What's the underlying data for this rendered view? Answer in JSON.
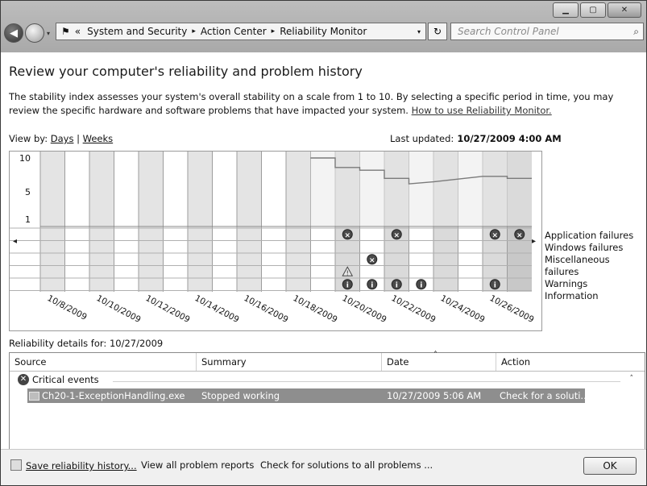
{
  "window": {
    "minimize": "▁",
    "maximize": "▢",
    "close": "✕"
  },
  "nav": {
    "back_icon": "back-arrow-icon",
    "forward_icon": "forward-arrow-icon",
    "recent_dropdown": "▾"
  },
  "address": {
    "prefix": "«",
    "crumbs": [
      "System and Security",
      "Action Center",
      "Reliability Monitor"
    ],
    "separator": "▸",
    "dropdown": "▾"
  },
  "refresh_label": "↻",
  "search": {
    "placeholder": "Search Control Panel",
    "icon": "⌕"
  },
  "page": {
    "title": "Review your computer's reliability and problem history",
    "description": "The stability index assesses your system's overall stability on a scale from 1 to 10. By selecting a specific period in time, you may review the specific hardware and software problems that have impacted your system.",
    "help_link": "How to use Reliability Monitor.",
    "view_by_label": "View by:",
    "view_days": "Days",
    "view_sep": "|",
    "view_weeks": "Weeks",
    "last_updated_label": "Last updated:",
    "last_updated_value": "10/27/2009 4:00 AM"
  },
  "chart_data": {
    "type": "line",
    "title": "",
    "y_ticks": [
      "10",
      "5",
      "1"
    ],
    "ylim": [
      1,
      10
    ],
    "x_labels": [
      "10/8/2009",
      "10/10/2009",
      "10/12/2009",
      "10/14/2009",
      "10/16/2009",
      "10/18/2009",
      "10/20/2009",
      "10/22/2009",
      "10/24/2009",
      "10/26/2009"
    ],
    "columns": 20,
    "first_data_column": 12,
    "stability_index": [
      {
        "column": 12,
        "value": 10
      },
      {
        "column": 13,
        "value": 8.6
      },
      {
        "column": 14,
        "value": 8.2
      },
      {
        "column": 15,
        "value": 7.0
      },
      {
        "column": 16,
        "value": 6.2
      },
      {
        "column": 17,
        "value": 6.5
      },
      {
        "column": 18,
        "value": 6.9
      },
      {
        "column": 19,
        "value": 7.3
      },
      {
        "column": 20,
        "value": 7.0
      }
    ],
    "rows": [
      "Application failures",
      "Windows failures",
      "Miscellaneous failures",
      "Warnings",
      "Information"
    ],
    "events": [
      {
        "column": 13,
        "row": 0,
        "kind": "error"
      },
      {
        "column": 15,
        "row": 0,
        "kind": "error"
      },
      {
        "column": 19,
        "row": 0,
        "kind": "error"
      },
      {
        "column": 20,
        "row": 0,
        "kind": "error"
      },
      {
        "column": 14,
        "row": 2,
        "kind": "error"
      },
      {
        "column": 13,
        "row": 3,
        "kind": "warning"
      },
      {
        "column": 13,
        "row": 4,
        "kind": "info"
      },
      {
        "column": 14,
        "row": 4,
        "kind": "info"
      },
      {
        "column": 15,
        "row": 4,
        "kind": "info"
      },
      {
        "column": 16,
        "row": 4,
        "kind": "info"
      },
      {
        "column": 19,
        "row": 4,
        "kind": "info"
      }
    ],
    "scroll_left": "◂",
    "scroll_right": "▸"
  },
  "details": {
    "header_label": "Reliability details for:",
    "header_date": "10/27/2009",
    "columns": [
      "Source",
      "Summary",
      "Date",
      "Action"
    ],
    "sort_indicator": "˄",
    "group_label": "Critical events",
    "group_collapse": "˄",
    "rows": [
      {
        "source": "Ch20-1-ExceptionHandling.exe",
        "summary": "Stopped working",
        "date": "10/27/2009 5:06 AM",
        "action": "Check for a soluti..."
      }
    ]
  },
  "footer": {
    "save_history": "Save reliability history...",
    "view_all": "View all problem reports",
    "check_solutions": "Check for solutions to all problems ...",
    "ok": "OK"
  }
}
